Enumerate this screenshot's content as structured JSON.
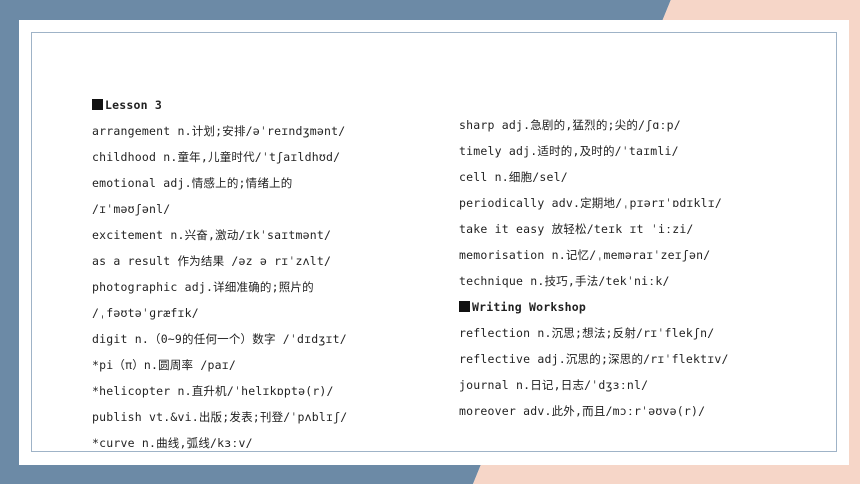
{
  "left_column": [
    {
      "type": "heading",
      "text": "Lesson 3"
    },
    {
      "type": "entry",
      "text": "arrangement n.计划;安排/əˈreɪndʒmənt/"
    },
    {
      "type": "entry",
      "text": "childhood n.童年,儿童时代/ˈtʃaɪldhʊd/"
    },
    {
      "type": "entry",
      "text": "emotional adj.情感上的;情绪上的"
    },
    {
      "type": "entry",
      "text": "/ɪˈməʊʃənl/"
    },
    {
      "type": "entry",
      "text": "excitement n.兴奋,激动/ɪkˈsaɪtmənt/"
    },
    {
      "type": "entry",
      "text": "as a result 作为结果 /əz ə rɪˈzʌlt/"
    },
    {
      "type": "entry",
      "text": "photographic adj.详细准确的;照片的"
    },
    {
      "type": "entry",
      "text": "/ˌfəʊtəˈɡræfɪk/"
    },
    {
      "type": "entry",
      "text": "digit n.（0~9的任何一个）数字 /ˈdɪdʒɪt/"
    },
    {
      "type": "entry",
      "text": "*pi（π）n.圆周率 /paɪ/"
    },
    {
      "type": "entry",
      "text": "*helicopter n.直升机/ˈhelɪkɒptə(r)/"
    },
    {
      "type": "entry",
      "text": "publish vt.&vi.出版;发表;刊登/ˈpʌblɪʃ/"
    },
    {
      "type": "entry",
      "text": "*curve n.曲线,弧线/kɜːv/"
    }
  ],
  "right_column": [
    {
      "type": "entry",
      "text": "sharp adj.急剧的,猛烈的;尖的/ʃɑːp/"
    },
    {
      "type": "entry",
      "text": "timely adj.适时的,及时的/ˈtaɪmli/"
    },
    {
      "type": "entry",
      "text": "cell n.细胞/sel/"
    },
    {
      "type": "entry",
      "text": "periodically adv.定期地/ˌpɪərɪˈɒdɪklɪ/"
    },
    {
      "type": "entry",
      "text": "take it easy 放轻松/teɪk ɪt ˈiːzi/"
    },
    {
      "type": "entry",
      "text": "memorisation n.记忆/ˌmeməraɪˈzeɪʃən/"
    },
    {
      "type": "entry",
      "text": "technique n.技巧,手法/tekˈniːk/"
    },
    {
      "type": "heading",
      "text": "Writing Workshop"
    },
    {
      "type": "entry",
      "text": "reflection n.沉思;想法;反射/rɪˈflekʃn/"
    },
    {
      "type": "entry",
      "text": "reflective adj.沉思的;深思的/rɪˈflektɪv/"
    },
    {
      "type": "entry",
      "text": "journal n.日记,日志/ˈdʒɜːnl/"
    },
    {
      "type": "entry",
      "text": "moreover adv.此外,而且/mɔːrˈəʊvə(r)/"
    }
  ]
}
